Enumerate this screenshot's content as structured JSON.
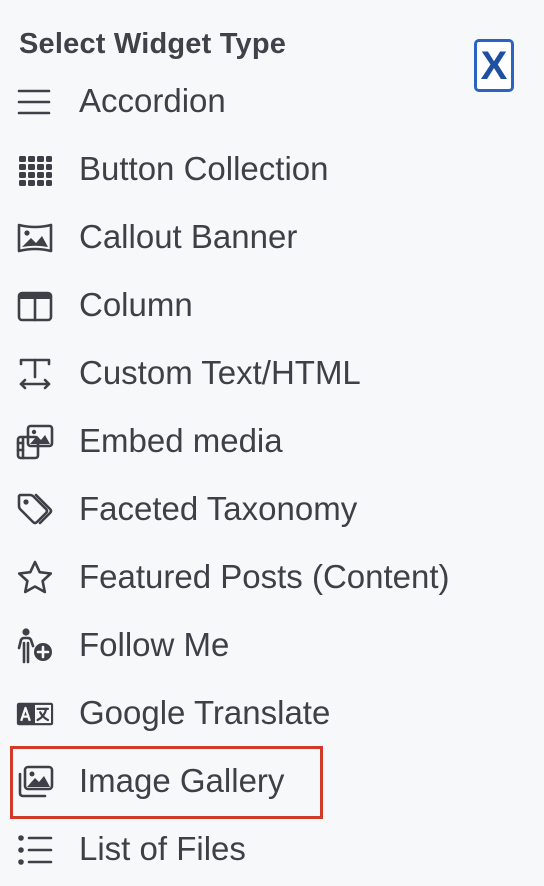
{
  "panel": {
    "title": "Select Widget Type",
    "close_label": "X",
    "highlight_color": "#cf3a2b",
    "accent_color": "#2a63c4"
  },
  "widgets": [
    {
      "label": "Accordion",
      "icon": "bars-icon"
    },
    {
      "label": "Button Collection",
      "icon": "grid-dots-icon"
    },
    {
      "label": "Callout Banner",
      "icon": "panorama-image-icon"
    },
    {
      "label": "Column",
      "icon": "columns-icon"
    },
    {
      "label": "Custom Text/HTML",
      "icon": "text-width-icon"
    },
    {
      "label": "Embed media",
      "icon": "photo-film-icon"
    },
    {
      "label": "Faceted Taxonomy",
      "icon": "tags-icon"
    },
    {
      "label": "Featured Posts (Content)",
      "icon": "star-icon"
    },
    {
      "label": "Follow Me",
      "icon": "person-plus-icon"
    },
    {
      "label": "Google Translate",
      "icon": "language-icon"
    },
    {
      "label": "Image Gallery",
      "icon": "images-icon",
      "highlighted": true
    },
    {
      "label": "List of Files",
      "icon": "list-icon"
    }
  ]
}
